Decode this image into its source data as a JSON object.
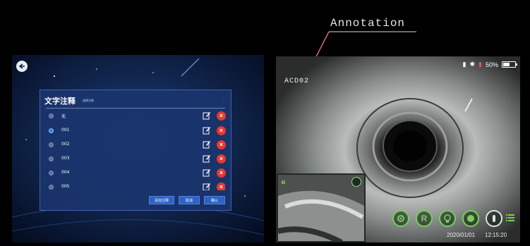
{
  "callout": {
    "label": "Annotation"
  },
  "left_screen": {
    "dialog": {
      "title": "文字注释",
      "subtitle": "选择注释",
      "items": [
        {
          "label": "无",
          "selected": false
        },
        {
          "label": "001",
          "selected": true
        },
        {
          "label": "002",
          "selected": false
        },
        {
          "label": "003",
          "selected": false
        },
        {
          "label": "004",
          "selected": false
        },
        {
          "label": "005",
          "selected": false
        }
      ],
      "buttons": {
        "add": "添加注释",
        "cancel": "取消",
        "confirm": "确认"
      }
    },
    "icons": {
      "back": "back-arrow-icon",
      "edit": "edit-icon",
      "delete": "delete-icon"
    }
  },
  "right_screen": {
    "camera_label": "ACD02",
    "status": {
      "battery_percent": 50,
      "battery_text": "50%"
    },
    "date": "2020/01/01",
    "time": "12:15:20",
    "controls": [
      "settings-icon",
      "record-icon",
      "lightbulb-icon",
      "snapshot-icon",
      "joystick-icon",
      "menu-icon"
    ],
    "accent_color": "#74d24f"
  }
}
